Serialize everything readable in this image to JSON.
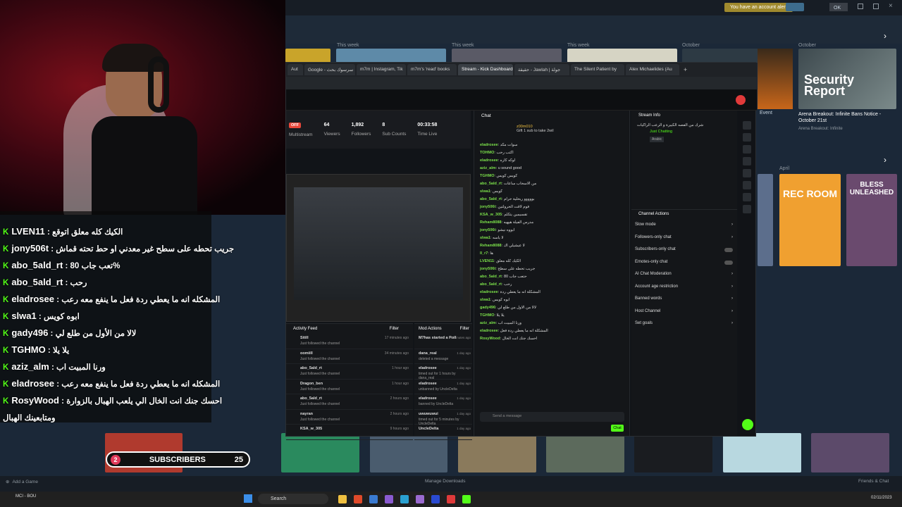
{
  "steam": {
    "alert": "You have an account alert",
    "account": "OK",
    "week_labels": [
      "This week",
      "This week",
      "This week",
      "October",
      "October"
    ],
    "featured": {
      "title_line1": "Security",
      "title_line2": "Report",
      "caption": "Arena Breakout: Infinite Bans Notice - October 21st",
      "sub": "Arena Breakout: Infinite"
    },
    "event_label": "Event",
    "april": "April",
    "games_right": [
      "REC ROOM",
      "BLESS UNLEASHED"
    ],
    "bottom_add_game": "Add a Game",
    "bottom_downloads": "Manage Downloads",
    "bottom_friends": "Friends & Chat"
  },
  "browser": {
    "tabs": [
      "Aut",
      "Google - سرسوك بحث",
      "m7m | Instagram, Tik",
      "m7m's 'read' books",
      "Stream - Kick Dashboard",
      "حقيقة - Jawlah | جولة",
      "The Silent Patient by",
      "Alex Michaelides (Au"
    ],
    "active_tab_index": 4
  },
  "stats": {
    "status": "OFF",
    "items": [
      {
        "value": "",
        "label": "Multistream"
      },
      {
        "value": "64",
        "label": "Viewers"
      },
      {
        "value": "1,892",
        "label": "Followers"
      },
      {
        "value": "8",
        "label": "Sub Counts"
      },
      {
        "value": "00:33:58",
        "label": "Time Live"
      }
    ]
  },
  "chat": {
    "title": "Chat",
    "pinned_user": "z00m010",
    "pinned_msg": "Gift 1 sub to take 2wil",
    "lines": [
      {
        "u": "eladrosee",
        "m": "سوات مكد"
      },
      {
        "u": "TOHMO",
        "m": "اكتب رحب"
      },
      {
        "u": "eladrosee",
        "m": "لوكه كاره"
      },
      {
        "u": "aziz_alm",
        "m": "u sound good"
      },
      {
        "u": "TGHMO",
        "m": "كويس كويس"
      },
      {
        "u": "abo_5ald_rt",
        "m": "من الاسحاب ساعات"
      },
      {
        "u": "slwa1",
        "m": "كويس"
      },
      {
        "u": "abo_5ald_rt",
        "m": "بووووو ريحلية حرام"
      },
      {
        "u": "jony506t",
        "m": "فوم لاقت الحرولتين"
      },
      {
        "u": "KSA_w_305",
        "m": "تقسيمين يتكلم"
      },
      {
        "u": "Reham8088",
        "m": "مدرس الفيلة هيهيه"
      },
      {
        "u": "jony506t",
        "m": "ابووه نيشو"
      },
      {
        "u": "slwa1",
        "m": "لا ياسه"
      },
      {
        "u": "Reham8088",
        "m": "لا عيشيلي اك"
      },
      {
        "u": "ll_r7",
        "m": "ها"
      },
      {
        "u": "LVEN11",
        "m": "الكيك كله معلق"
      },
      {
        "u": "jony506t",
        "m": "جريب تحطه على سطح"
      },
      {
        "u": "abo_5ald_rt",
        "m": "80 حتعب جاب"
      },
      {
        "u": "abo_5ald_rt",
        "m": "رحب"
      },
      {
        "u": "eladrosee",
        "m": "المشكلة انه ما يعطي ردة"
      },
      {
        "u": "slwa1",
        "m": "ابوه كويس"
      },
      {
        "u": "gady496",
        "m": "لالا من الاول من طلع لي"
      },
      {
        "u": "TGHMO",
        "m": "يلا يلا"
      },
      {
        "u": "aziz_alm",
        "m": "ورنا المبيت اب"
      },
      {
        "u": "eladrosee",
        "m": "المشكلة انه ما يعطي ردة فعل"
      },
      {
        "u": "RosyWood",
        "m": "احسك جنك انت الخال"
      }
    ],
    "input_placeholder": "Send a message",
    "send_label": "Chat"
  },
  "stream_info": {
    "title": "Stream Info",
    "stream_title": "شرك من الفصه الكبيرة و الرعب الراكيات",
    "category": "Just Chatting",
    "tag": "Arabic"
  },
  "channel_actions": {
    "title": "Channel Actions",
    "items": [
      "Slow mode",
      "Followers-only chat",
      "Subscribers-only chat",
      "Emotes-only chat",
      "AI Chat Moderation",
      "Account age restriction",
      "Banned words",
      "Host Channel",
      "Set goals"
    ]
  },
  "activity": {
    "title": "Activity Feed",
    "filter": "Filter",
    "items": [
      {
        "user": "Sitill",
        "action": "Just followed the channel",
        "time": "17 minutes ago"
      },
      {
        "user": "oomiill",
        "action": "Just followed the channel",
        "time": "34 minutes ago"
      },
      {
        "user": "abo_5ald_rt",
        "action": "Just followed the channel",
        "time": "1 hour ago"
      },
      {
        "user": "Dragon_ben",
        "action": "Just followed the channel",
        "time": "1 hour ago"
      },
      {
        "user": "abo_5ald_rt",
        "action": "Just followed the channel",
        "time": "2 hours ago"
      },
      {
        "user": "nayran",
        "action": "Just followed the channel",
        "time": "2 hours ago"
      },
      {
        "user": "KSA_w_305",
        "action": "",
        "time": "9 hours ago"
      }
    ]
  },
  "mod": {
    "title": "Mod Actions",
    "filter": "Filter",
    "items": [
      {
        "user": "M7has started a Poll",
        "action": "",
        "time": "0 minutes ago"
      },
      {
        "user": "dana_real",
        "action": "deleted a message",
        "time": "1 day ago"
      },
      {
        "user": "eladrosee",
        "action": "timed out for 1 hours by dana_real",
        "time": "1 day ago"
      },
      {
        "user": "eladrosee",
        "action": "unbanned by UncleDelta",
        "time": "1 day ago"
      },
      {
        "user": "eladrosee",
        "action": "banned by UncleDelta",
        "time": "1 day ago"
      },
      {
        "user": "uwuwuwui",
        "action": "timed out for 5 minutes by UncleDelta",
        "time": "1 day ago"
      },
      {
        "user": "UncleDelta",
        "action": "",
        "time": "1 day ago"
      }
    ]
  },
  "overlay_chat": [
    {
      "name": "LVEN11",
      "msg": "الكيك كله معلق اتوقع"
    },
    {
      "name": "jony506t",
      "msg": "جريب تحطه على سطح غير معدني او حط تحته قماش"
    },
    {
      "name": "abo_5ald_rt",
      "msg": "80 تعب جاب%"
    },
    {
      "name": "abo_5ald_rt",
      "msg": "رحب"
    },
    {
      "name": "eladrosee",
      "msg": "المشكله انه ما يعطي ردة فعل ما ينفع معه رعب"
    },
    {
      "name": "slwa1",
      "msg": "ابوه كويس"
    },
    {
      "name": "gady496",
      "msg": "لالا من الأول من طلع لي"
    },
    {
      "name": "TGHMO",
      "msg": "يلا يلا"
    },
    {
      "name": "aziz_alm",
      "msg": "ورنا المبيت اب"
    },
    {
      "name": "eladrosee",
      "msg": "المشكله انه ما يعطي ردة فعل ما ينفع معه رعب"
    },
    {
      "name": "RosyWood",
      "msg": "احسك جنك انت الخال الي يلعب الهبال بالزوارة"
    },
    {
      "name": "",
      "msg": "ومتابعينك الهبال"
    }
  ],
  "subs": {
    "count_left": "2",
    "label": "SUBSCRIBERS",
    "count_right": "25"
  },
  "viewers_badge": "64",
  "taskbar": {
    "search": "Search",
    "left_label": "MCI - BOU",
    "date": "02/11/2023"
  }
}
